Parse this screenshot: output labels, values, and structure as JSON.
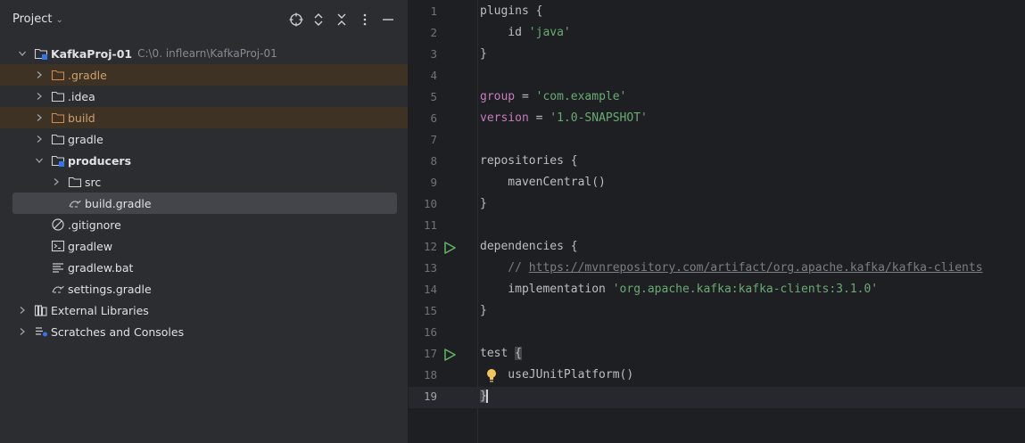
{
  "panel": {
    "title": "Project",
    "header_icons": [
      "crosshair-icon",
      "expand-icon",
      "collapse-icon",
      "more-icon",
      "minimize-icon"
    ],
    "tree": [
      {
        "depth": 0,
        "expanded": true,
        "icon": "module-folder-icon",
        "label": "KafkaProj-01",
        "bold": true,
        "path": "C:\\0. inflearn\\KafkaProj-01"
      },
      {
        "depth": 1,
        "expanded": false,
        "icon": "folder-orange-icon",
        "label": ".gradle",
        "ignored": true
      },
      {
        "depth": 1,
        "expanded": false,
        "icon": "folder-icon",
        "label": ".idea"
      },
      {
        "depth": 1,
        "expanded": false,
        "icon": "folder-orange-icon",
        "label": "build",
        "ignored": true
      },
      {
        "depth": 1,
        "expanded": false,
        "icon": "folder-icon",
        "label": "gradle"
      },
      {
        "depth": 1,
        "expanded": true,
        "icon": "module-folder-icon",
        "label": "producers",
        "bold": true
      },
      {
        "depth": 2,
        "expanded": false,
        "icon": "folder-icon",
        "label": "src"
      },
      {
        "depth": 2,
        "icon": "gradle-icon",
        "label": "build.gradle",
        "selected": true
      },
      {
        "depth": 1,
        "icon": "gitignore-icon",
        "label": ".gitignore"
      },
      {
        "depth": 1,
        "icon": "terminal-file-icon",
        "label": "gradlew"
      },
      {
        "depth": 1,
        "icon": "text-file-icon",
        "label": "gradlew.bat"
      },
      {
        "depth": 1,
        "icon": "gradle-icon",
        "label": "settings.gradle"
      },
      {
        "depth": 0,
        "expanded": false,
        "icon": "library-icon",
        "label": "External Libraries"
      },
      {
        "depth": 0,
        "expanded": false,
        "icon": "scratches-icon",
        "label": "Scratches and Consoles"
      }
    ]
  },
  "editor": {
    "lines": [
      {
        "n": "1",
        "tokens": [
          {
            "t": "plugins {",
            "c": ""
          }
        ]
      },
      {
        "n": "2",
        "tokens": [
          {
            "t": "    id ",
            "c": ""
          },
          {
            "t": "'java'",
            "c": "k-str"
          }
        ]
      },
      {
        "n": "3",
        "tokens": [
          {
            "t": "}",
            "c": ""
          }
        ]
      },
      {
        "n": "4",
        "tokens": []
      },
      {
        "n": "5",
        "tokens": [
          {
            "t": "group",
            "c": "k-prop"
          },
          {
            "t": " = ",
            "c": ""
          },
          {
            "t": "'com.example'",
            "c": "k-str"
          }
        ]
      },
      {
        "n": "6",
        "tokens": [
          {
            "t": "version",
            "c": "k-prop"
          },
          {
            "t": " = ",
            "c": ""
          },
          {
            "t": "'1.0-SNAPSHOT'",
            "c": "k-str"
          }
        ]
      },
      {
        "n": "7",
        "tokens": []
      },
      {
        "n": "8",
        "tokens": [
          {
            "t": "repositories {",
            "c": ""
          }
        ]
      },
      {
        "n": "9",
        "tokens": [
          {
            "t": "    mavenCentral()",
            "c": ""
          }
        ]
      },
      {
        "n": "10",
        "tokens": [
          {
            "t": "}",
            "c": ""
          }
        ]
      },
      {
        "n": "11",
        "tokens": []
      },
      {
        "n": "12",
        "run": true,
        "tokens": [
          {
            "t": "dependencies {",
            "c": ""
          }
        ]
      },
      {
        "n": "13",
        "tokens": [
          {
            "t": "    // ",
            "c": "k-com"
          },
          {
            "t": "https://mvnrepository.com/artifact/org.apache.kafka/kafka-clients",
            "c": "k-link"
          }
        ]
      },
      {
        "n": "14",
        "tokens": [
          {
            "t": "    implementation ",
            "c": ""
          },
          {
            "t": "'org.apache.kafka:kafka-clients:3.1.0'",
            "c": "k-str"
          }
        ]
      },
      {
        "n": "15",
        "tokens": [
          {
            "t": "}",
            "c": ""
          }
        ]
      },
      {
        "n": "16",
        "tokens": []
      },
      {
        "n": "17",
        "run": true,
        "tokens": [
          {
            "t": "test ",
            "c": ""
          },
          {
            "t": "{",
            "c": "brace-hl"
          }
        ]
      },
      {
        "n": "18",
        "bulb": true,
        "tokens": [
          {
            "t": "    useJUnitPlatform()",
            "c": ""
          }
        ]
      },
      {
        "n": "19",
        "current": true,
        "tokens": [
          {
            "t": "}",
            "c": "brace-hl cursor-after"
          }
        ]
      }
    ]
  }
}
